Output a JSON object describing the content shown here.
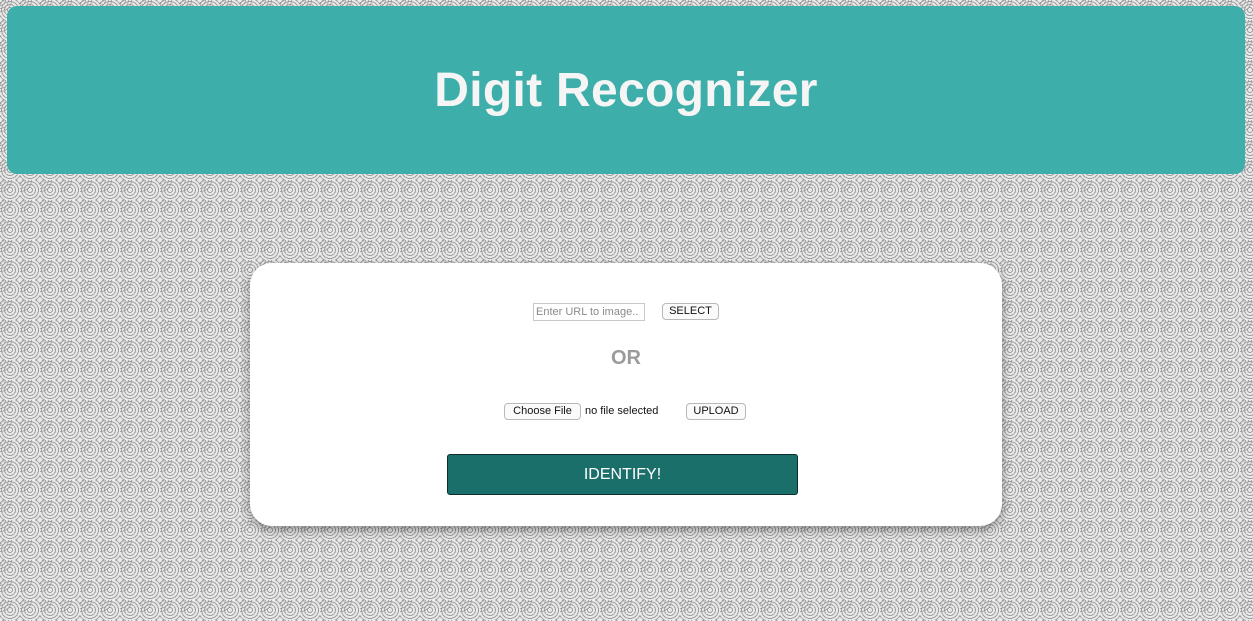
{
  "header": {
    "title": "Digit Recognizer"
  },
  "form": {
    "url_placeholder": "Enter URL to image..",
    "url_value": "",
    "select_label": "SELECT",
    "or_label": "OR",
    "choose_file_label": "Choose File",
    "file_status": "no file selected",
    "upload_label": "UPLOAD",
    "identify_label": "IDENTIFY!"
  },
  "colors": {
    "header_background": "#3daea9",
    "identify_button": "#1a6f6b",
    "card_background": "#ffffff",
    "or_text": "#9b9b9b"
  }
}
